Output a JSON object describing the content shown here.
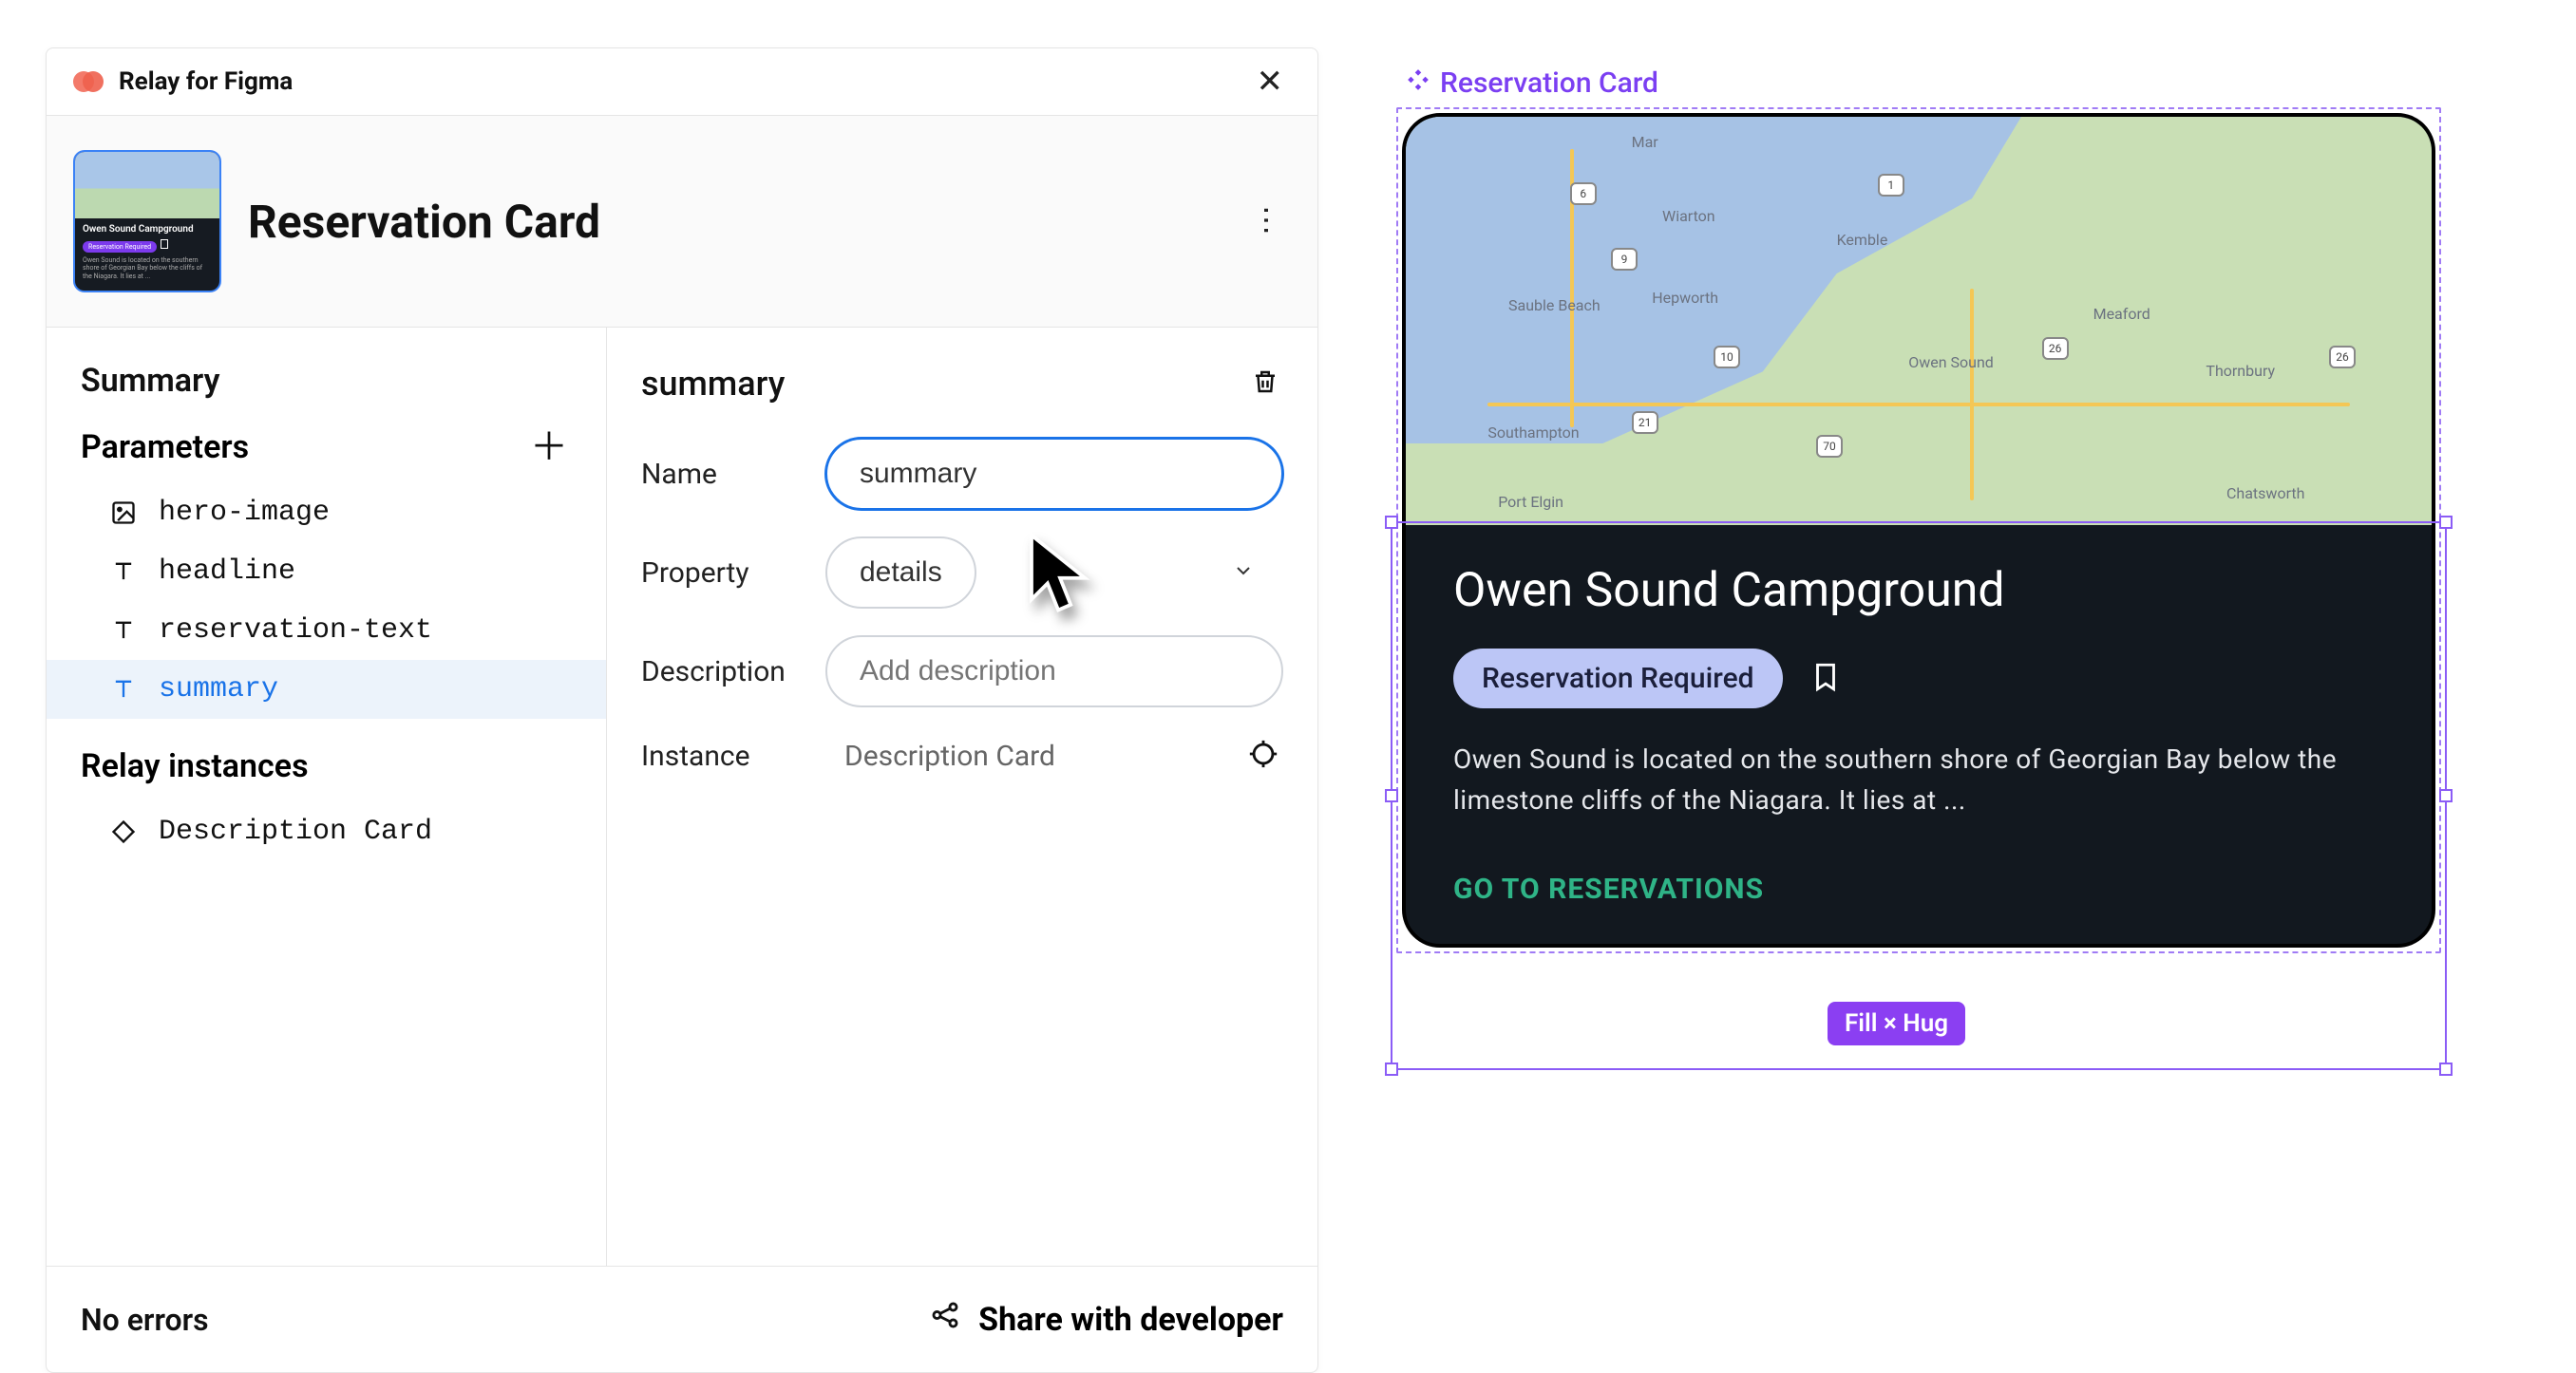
{
  "plugin": {
    "name": "Relay for Figma",
    "component_title": "Reservation Card",
    "left": {
      "summary_heading": "Summary",
      "parameters_heading": "Parameters",
      "params": [
        {
          "icon": "image",
          "name": "hero-image"
        },
        {
          "icon": "text",
          "name": "headline"
        },
        {
          "icon": "text",
          "name": "reservation-text"
        },
        {
          "icon": "text",
          "name": "summary",
          "selected": true
        }
      ],
      "instances_heading": "Relay instances",
      "instances": [
        {
          "icon": "diamond",
          "name": "Description Card"
        }
      ]
    },
    "right": {
      "heading": "summary",
      "fields": {
        "name_label": "Name",
        "name_value": "summary",
        "property_label": "Property",
        "property_value": "details",
        "description_label": "Description",
        "description_placeholder": "Add description",
        "instance_label": "Instance",
        "instance_value": "Description Card"
      }
    },
    "footer": {
      "status": "No errors",
      "share_label": "Share with developer"
    }
  },
  "canvas": {
    "frame_label": "Reservation Card",
    "card": {
      "title": "Owen Sound Campground",
      "badge": "Reservation Required",
      "description": "Owen Sound is located on the southern shore of Georgian Bay below the limestone cliffs of the Niagara. It lies at ...",
      "cta": "GO TO RESERVATIONS"
    },
    "map_labels": {
      "mar": "Mar",
      "wiarton": "Wiarton",
      "kemble": "Kemble",
      "sauble": "Sauble Beach",
      "hepworth": "Hepworth",
      "owensound": "Owen Sound",
      "meaford": "Meaford",
      "southampton": "Southampton",
      "thornbury": "Thornbury",
      "portelgin": "Port Elgin",
      "chatsworth": "Chatsworth"
    },
    "map_shields": {
      "s6": "6",
      "s9": "9",
      "s1": "1",
      "s10": "10",
      "s21": "21",
      "s70": "70",
      "s26a": "26",
      "s26b": "26"
    },
    "selection_badge": "Fill × Hug",
    "thumb": {
      "headline": "Owen Sound Campground",
      "badge": "Reservation Required",
      "desc": "Owen Sound is located on the southern shore of Georgian Bay below the cliffs of the Niagara. It lies at ..."
    }
  }
}
